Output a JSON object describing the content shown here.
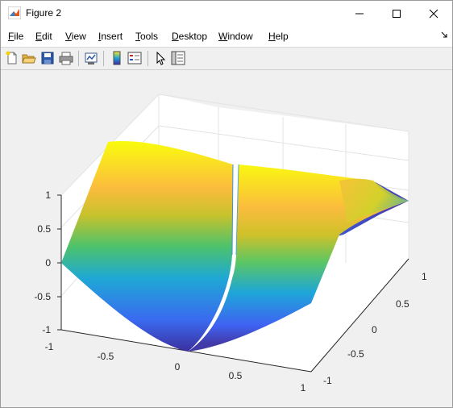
{
  "window": {
    "title": "Figure 2"
  },
  "menu": [
    {
      "prefix": "",
      "u": "F",
      "rest": "ile"
    },
    {
      "prefix": "",
      "u": "E",
      "rest": "dit"
    },
    {
      "prefix": "",
      "u": "V",
      "rest": "iew"
    },
    {
      "prefix": "",
      "u": "I",
      "rest": "nsert"
    },
    {
      "prefix": "",
      "u": "T",
      "rest": "ools"
    },
    {
      "prefix": "",
      "u": "D",
      "rest": "esktop"
    },
    {
      "prefix": "",
      "u": "W",
      "rest": "indow"
    },
    {
      "prefix": "",
      "u": "H",
      "rest": "elp"
    }
  ],
  "toolbar_icons": [
    "new-figure-icon",
    "open-file-icon",
    "save-icon",
    "print-icon",
    "link-plot-icon",
    "insert-colorbar-icon",
    "insert-legend-icon",
    "pointer-icon",
    "property-inspector-icon"
  ],
  "axes": {
    "z_ticks": [
      "1",
      "0.5",
      "0",
      "-0.5",
      "-1"
    ],
    "x_ticks": [
      "-1",
      "-0.5",
      "0",
      "0.5",
      "1"
    ],
    "y_ticks": [
      "1",
      "0.5",
      "0",
      "-0.5",
      "-1"
    ]
  },
  "colors": {
    "colormap": "parula"
  }
}
